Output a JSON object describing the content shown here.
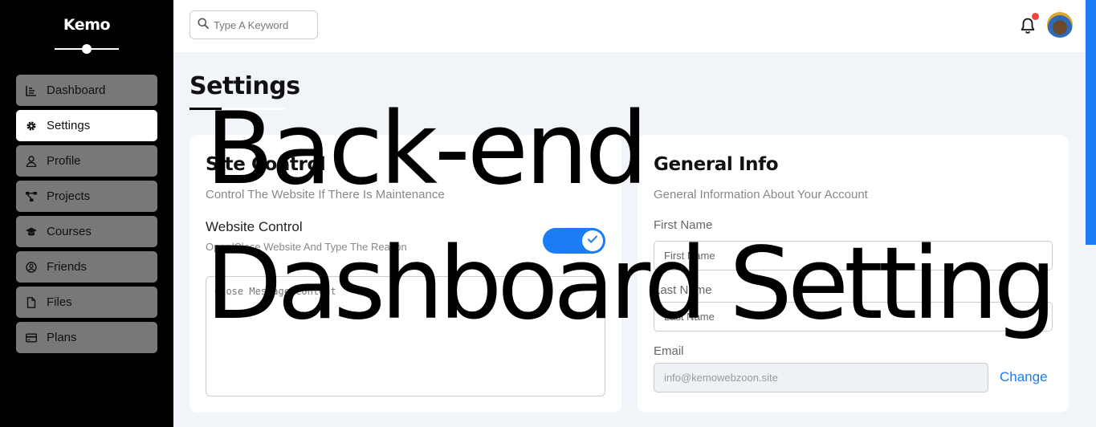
{
  "sidebar": {
    "brand": "Kemo",
    "items": [
      {
        "label": "Dashboard",
        "icon": "chart-line-icon",
        "active": false
      },
      {
        "label": "Settings",
        "icon": "gear-icon",
        "active": true
      },
      {
        "label": "Profile",
        "icon": "user-icon",
        "active": false
      },
      {
        "label": "Projects",
        "icon": "diagram-project-icon",
        "active": false
      },
      {
        "label": "Courses",
        "icon": "graduation-cap-icon",
        "active": false
      },
      {
        "label": "Friends",
        "icon": "circle-user-icon",
        "active": false
      },
      {
        "label": "Files",
        "icon": "file-icon",
        "active": false
      },
      {
        "label": "Plans",
        "icon": "credit-card-icon",
        "active": false
      }
    ]
  },
  "header": {
    "search_placeholder": "Type A Keyword",
    "notifications_unread": true
  },
  "page": {
    "title": "Settings"
  },
  "site_control": {
    "title": "Site Control",
    "subtitle": "Control The Website If There Is Maintenance",
    "website_control_label": "Website Control",
    "website_control_desc": "Open/Close Website And Type The Reason",
    "toggle_on": true,
    "message_placeholder": "Close Message Content"
  },
  "general_info": {
    "title": "General Info",
    "subtitle": "General Information About Your Account",
    "first_name_label": "First Name",
    "first_name_placeholder": "First Name",
    "last_name_label": "Last Name",
    "last_name_placeholder": "Last Name",
    "email_label": "Email",
    "email_value": "info@kemowebzoon.site",
    "change_label": "Change"
  },
  "overlay": {
    "line1": "Back-end",
    "line2": "Dashboard Setting"
  },
  "colors": {
    "accent": "#1b7cf3",
    "sidebar_bg": "#000000",
    "nav_item_bg": "#787878",
    "page_bg": "#f1f4f9",
    "notification_dot": "#f44336"
  }
}
